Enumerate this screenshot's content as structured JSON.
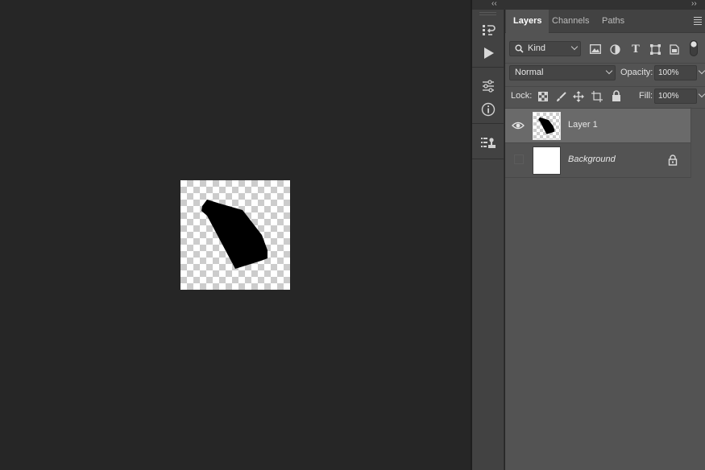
{
  "panel": {
    "collapse_left": "‹‹",
    "collapse_right": "››",
    "tabs": [
      {
        "label": "Layers",
        "active": true
      },
      {
        "label": "Channels",
        "active": false
      },
      {
        "label": "Paths",
        "active": false
      }
    ],
    "filter": {
      "kind_label": "Kind"
    },
    "blend_mode": "Normal",
    "opacity_label": "Opacity:",
    "opacity_value": "100%",
    "lock_label": "Lock:",
    "fill_label": "Fill:",
    "fill_value": "100%"
  },
  "layers": [
    {
      "name": "Layer 1",
      "visible": true,
      "selected": true,
      "locked": false
    },
    {
      "name": "Background",
      "visible": false,
      "selected": false,
      "locked": true
    }
  ],
  "tool_strip": {
    "icons": [
      "history-icon",
      "play-icon",
      "adjustments-icon",
      "info-icon",
      "properties-icon"
    ]
  },
  "colors": {
    "app_bg": "#262626",
    "panel_bg": "#535353",
    "selected_layer": "#6a6a6a",
    "shape_fill": "#000000"
  }
}
